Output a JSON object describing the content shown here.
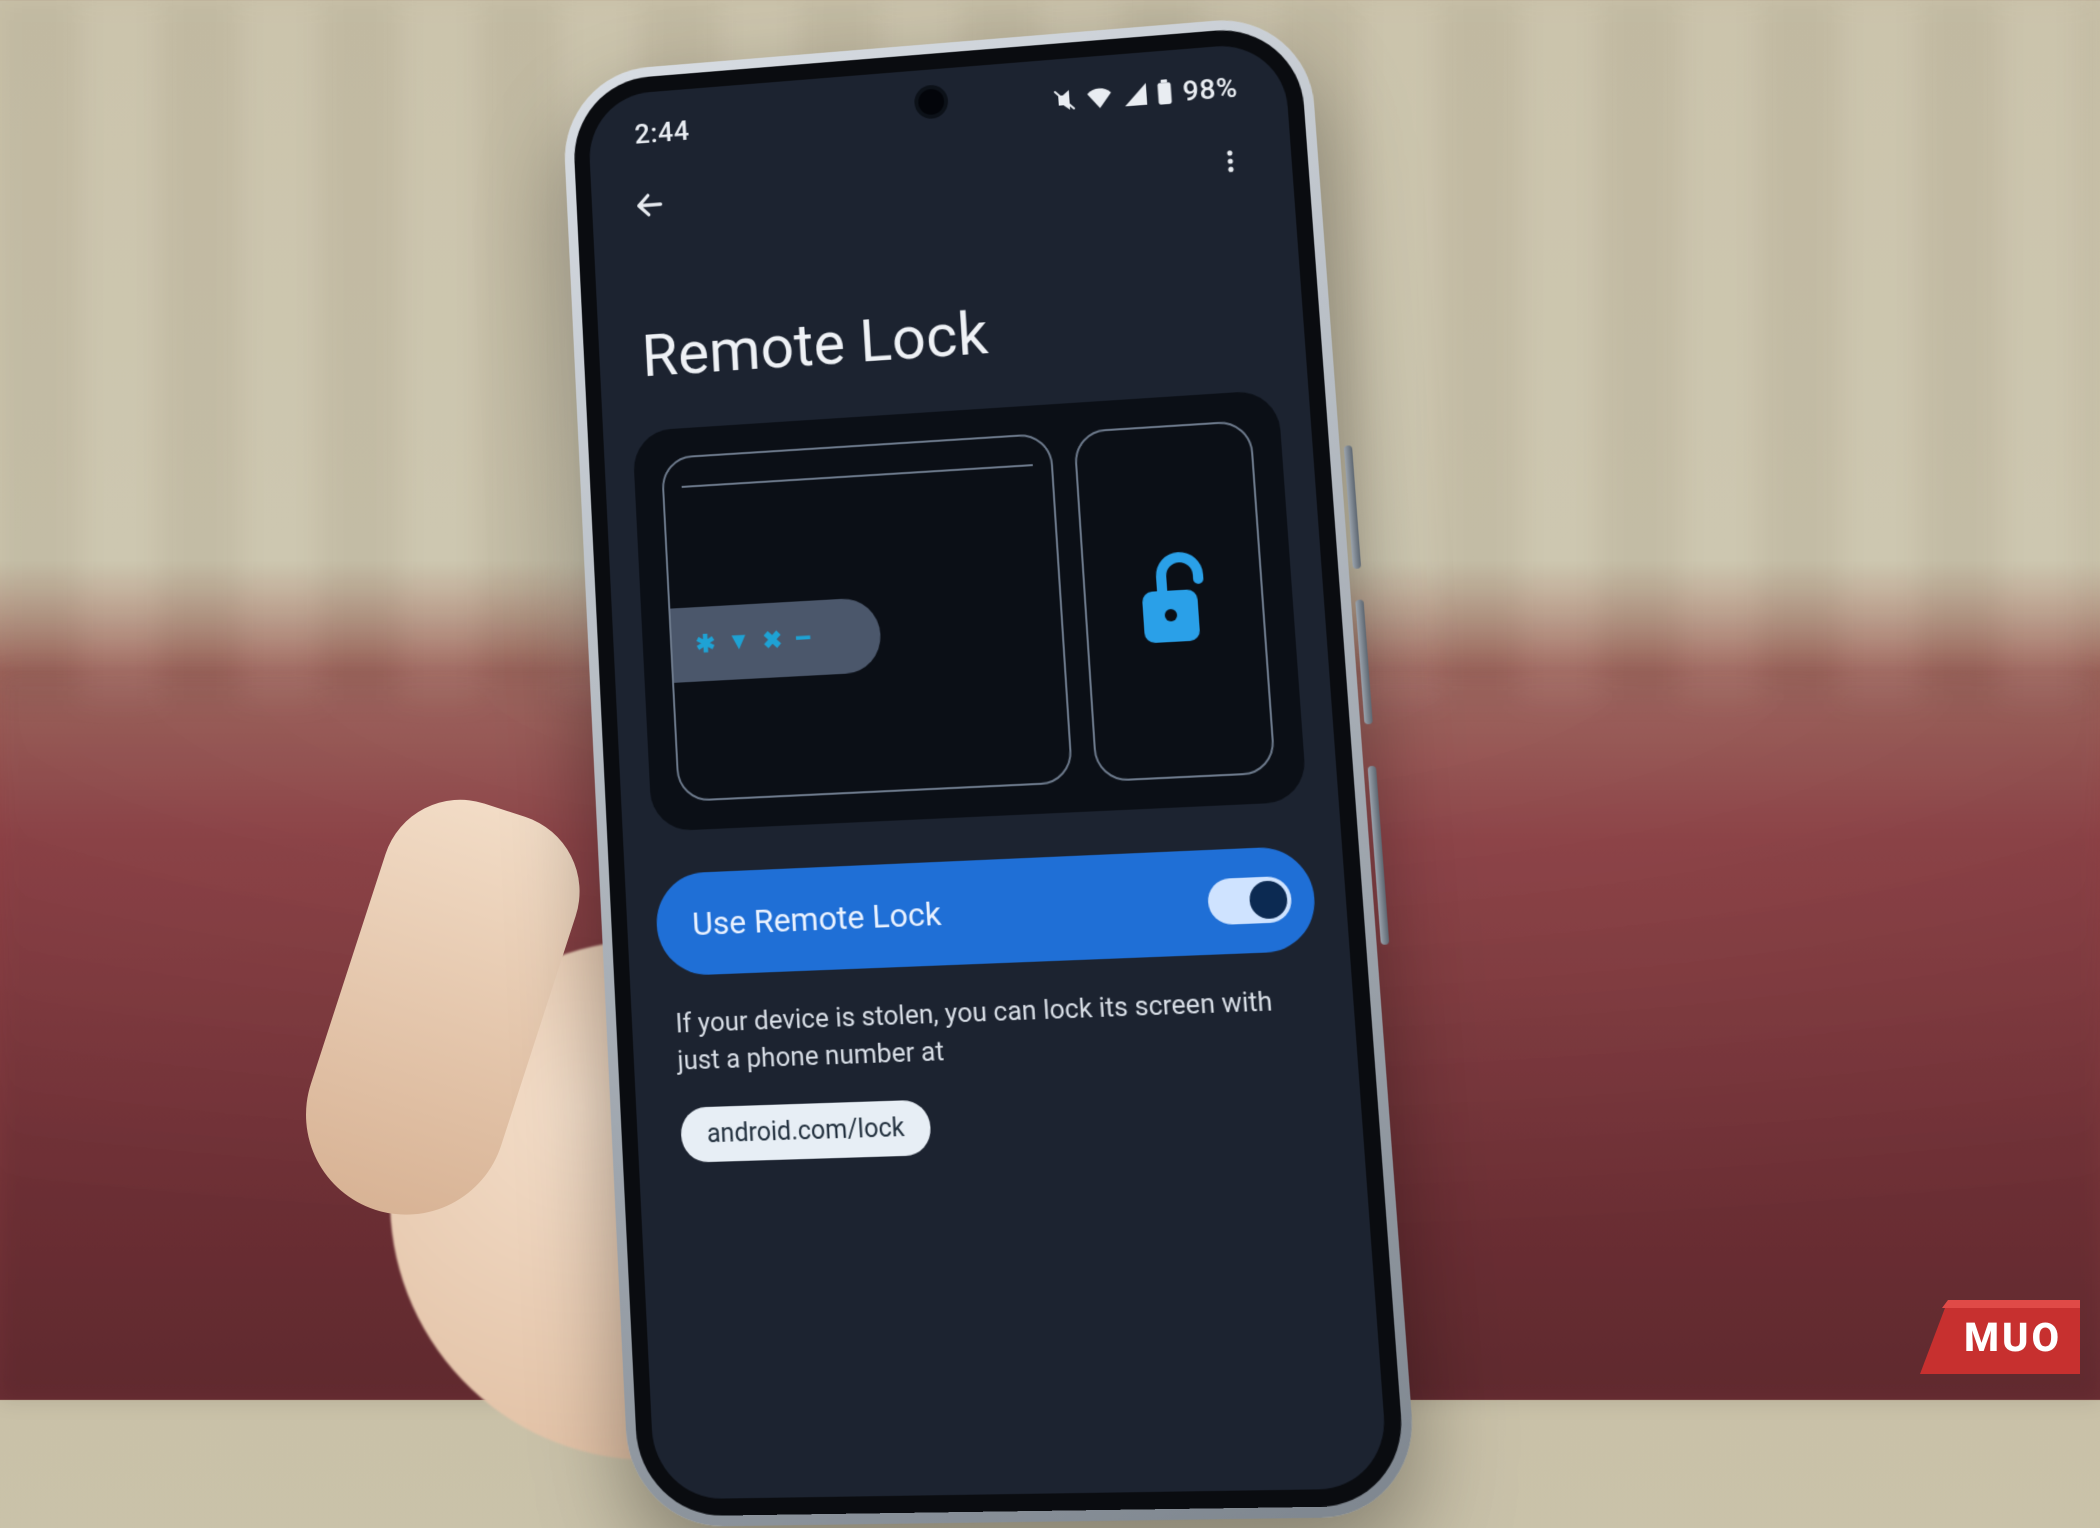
{
  "status": {
    "time": "2:44",
    "battery_pct": "98%"
  },
  "page": {
    "title": "Remote Lock"
  },
  "toggle": {
    "label": "Use Remote Lock",
    "state_on": true
  },
  "description": "If your device is stolen, you can lock its screen with just a phone number at",
  "link_chip": "android.com/lock",
  "watermark": "MUO",
  "colors": {
    "accent": "#1f6fd6",
    "accent_light": "#2aa0e8",
    "screen_bg": "#1c2330"
  }
}
